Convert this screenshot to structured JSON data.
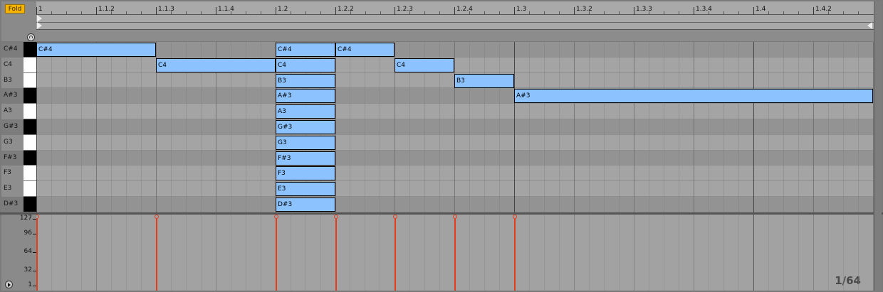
{
  "header": {
    "fold_label": "Fold"
  },
  "icons": {
    "headphone": "headphone-icon",
    "play": "play-icon",
    "loop_start": "triangle-right-icon",
    "loop_end": "triangle-left-icon"
  },
  "ruler": {
    "labels": [
      "1",
      "1.1.2",
      "1.1.3",
      "1.1.4",
      "1.2",
      "1.2.2",
      "1.2.3",
      "1.2.4",
      "1.3",
      "1.3.2",
      "1.3.3",
      "1.3.4",
      "1.4",
      "1.4.2"
    ]
  },
  "keys": [
    {
      "label": "C#4",
      "black": true
    },
    {
      "label": "C4",
      "black": false
    },
    {
      "label": "B3",
      "black": false
    },
    {
      "label": "A#3",
      "black": true
    },
    {
      "label": "A3",
      "black": false
    },
    {
      "label": "G#3",
      "black": true
    },
    {
      "label": "G3",
      "black": false
    },
    {
      "label": "F#3",
      "black": true
    },
    {
      "label": "F3",
      "black": false
    },
    {
      "label": "E3",
      "black": false
    },
    {
      "label": "D#3",
      "black": true
    }
  ],
  "notes": [
    {
      "pitch": "C#4",
      "start": 0,
      "length": 2
    },
    {
      "pitch": "C4",
      "start": 2,
      "length": 2
    },
    {
      "pitch": "C#4",
      "start": 4,
      "length": 1
    },
    {
      "pitch": "C#4",
      "start": 5,
      "length": 1
    },
    {
      "pitch": "C4",
      "start": 4,
      "length": 1
    },
    {
      "pitch": "B3",
      "start": 4,
      "length": 1
    },
    {
      "pitch": "A#3",
      "start": 4,
      "length": 1
    },
    {
      "pitch": "A3",
      "start": 4,
      "length": 1
    },
    {
      "pitch": "G#3",
      "start": 4,
      "length": 1
    },
    {
      "pitch": "G3",
      "start": 4,
      "length": 1
    },
    {
      "pitch": "F#3",
      "start": 4,
      "length": 1
    },
    {
      "pitch": "F3",
      "start": 4,
      "length": 1
    },
    {
      "pitch": "E3",
      "start": 4,
      "length": 1
    },
    {
      "pitch": "D#3",
      "start": 4,
      "length": 1
    },
    {
      "pitch": "C4",
      "start": 6,
      "length": 1
    },
    {
      "pitch": "B3",
      "start": 7,
      "length": 1
    },
    {
      "pitch": "A#3",
      "start": 8,
      "length": 6
    }
  ],
  "velocity": {
    "scale": [
      "127",
      "96",
      "64",
      "32",
      "1"
    ],
    "zoom_label": "1/64",
    "colors": {
      "stem": "#e83a1c"
    }
  },
  "colors": {
    "note_fill": "#8cc3ff",
    "fold_button": "#f5b400"
  }
}
